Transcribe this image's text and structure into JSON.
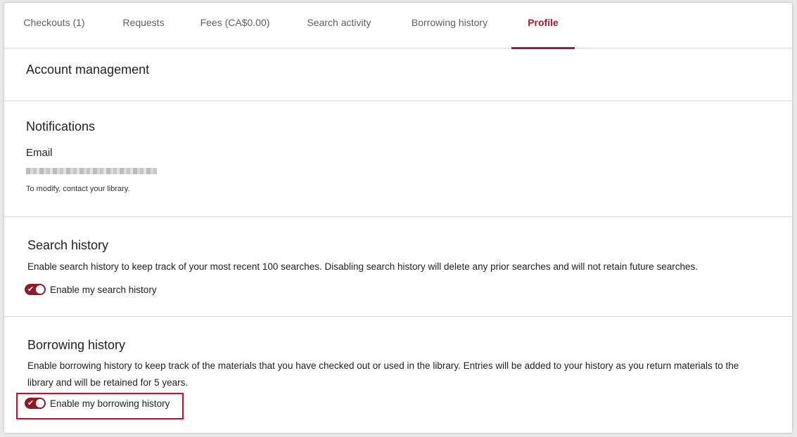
{
  "tabs": [
    {
      "label": "Checkouts (1)"
    },
    {
      "label": "Requests"
    },
    {
      "label": "Fees (CA$0.00)"
    },
    {
      "label": "Search activity"
    },
    {
      "label": "Borrowing history"
    },
    {
      "label": "Profile",
      "active": true
    }
  ],
  "account": {
    "title": "Account management"
  },
  "notifications": {
    "title": "Notifications",
    "email_label": "Email",
    "note": "To modify, contact your library."
  },
  "search_history": {
    "title": "Search history",
    "description": "Enable search history to keep track of your most recent 100 searches. Disabling search history will delete any prior searches and will not retain future searches.",
    "toggle_label": "Enable my search history",
    "enabled": true
  },
  "borrowing_history": {
    "title": "Borrowing history",
    "description": "Enable borrowing history to keep track of the materials that you have checked out or used in the library. Entries will be added to your history as you return materials to the library and will be retained for 5 years.",
    "toggle_label": "Enable my borrowing history",
    "enabled": true
  },
  "colors": {
    "accent": "#9b1c2e",
    "highlight": "#c8102e"
  }
}
